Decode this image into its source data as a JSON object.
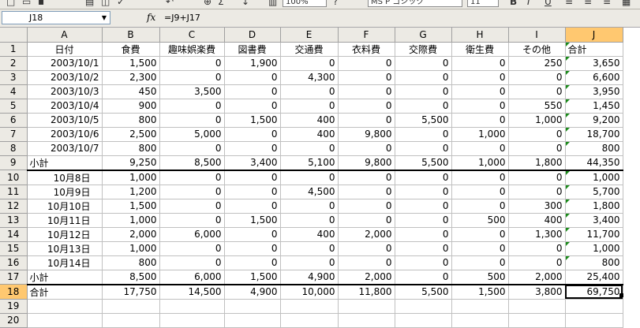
{
  "toolbar": {
    "zoom": "100%",
    "font_name": "MS P ゴシック",
    "font_size": "11",
    "bold": "B",
    "italic": "I",
    "underline": "U"
  },
  "formula_bar": {
    "name_box": "J18",
    "fx": "fx",
    "formula": "=J9+J17"
  },
  "sheet": {
    "columns": [
      "A",
      "B",
      "C",
      "D",
      "E",
      "F",
      "G",
      "H",
      "I",
      "J"
    ],
    "selected_cell": "J18",
    "rows": [
      {
        "n": "1",
        "cells": [
          "日付",
          "食費",
          "趣味娯楽費",
          "図書費",
          "交通費",
          "衣料費",
          "交際費",
          "衛生費",
          "その他",
          "合計"
        ]
      },
      {
        "n": "2",
        "cells": [
          "2003/10/1",
          "1,500",
          "0",
          "1,900",
          "0",
          "0",
          "0",
          "0",
          "250",
          "3,650"
        ]
      },
      {
        "n": "3",
        "cells": [
          "2003/10/2",
          "2,300",
          "0",
          "0",
          "4,300",
          "0",
          "0",
          "0",
          "0",
          "6,600"
        ]
      },
      {
        "n": "4",
        "cells": [
          "2003/10/3",
          "450",
          "3,500",
          "0",
          "0",
          "0",
          "0",
          "0",
          "0",
          "3,950"
        ]
      },
      {
        "n": "5",
        "cells": [
          "2003/10/4",
          "900",
          "0",
          "0",
          "0",
          "0",
          "0",
          "0",
          "550",
          "1,450"
        ]
      },
      {
        "n": "6",
        "cells": [
          "2003/10/5",
          "800",
          "0",
          "1,500",
          "400",
          "0",
          "5,500",
          "0",
          "1,000",
          "9,200"
        ]
      },
      {
        "n": "7",
        "cells": [
          "2003/10/6",
          "2,500",
          "5,000",
          "0",
          "400",
          "9,800",
          "0",
          "1,000",
          "0",
          "18,700"
        ]
      },
      {
        "n": "8",
        "cells": [
          "2003/10/7",
          "800",
          "0",
          "0",
          "0",
          "0",
          "0",
          "0",
          "0",
          "800"
        ]
      },
      {
        "n": "9",
        "cells": [
          "小計",
          "9,250",
          "8,500",
          "3,400",
          "5,100",
          "9,800",
          "5,500",
          "1,000",
          "1,800",
          "44,350"
        ]
      },
      {
        "n": "10",
        "cells": [
          "10月8日",
          "1,000",
          "0",
          "0",
          "0",
          "0",
          "0",
          "0",
          "0",
          "1,000"
        ]
      },
      {
        "n": "11",
        "cells": [
          "10月9日",
          "1,200",
          "0",
          "0",
          "4,500",
          "0",
          "0",
          "0",
          "0",
          "5,700"
        ]
      },
      {
        "n": "12",
        "cells": [
          "10月10日",
          "1,500",
          "0",
          "0",
          "0",
          "0",
          "0",
          "0",
          "300",
          "1,800"
        ]
      },
      {
        "n": "13",
        "cells": [
          "10月11日",
          "1,000",
          "0",
          "1,500",
          "0",
          "0",
          "0",
          "500",
          "400",
          "3,400"
        ]
      },
      {
        "n": "14",
        "cells": [
          "10月12日",
          "2,000",
          "6,000",
          "0",
          "400",
          "2,000",
          "0",
          "0",
          "1,300",
          "11,700"
        ]
      },
      {
        "n": "15",
        "cells": [
          "10月13日",
          "1,000",
          "0",
          "0",
          "0",
          "0",
          "0",
          "0",
          "0",
          "1,000"
        ]
      },
      {
        "n": "16",
        "cells": [
          "10月14日",
          "800",
          "0",
          "0",
          "0",
          "0",
          "0",
          "0",
          "0",
          "800"
        ]
      },
      {
        "n": "17",
        "cells": [
          "小計",
          "8,500",
          "6,000",
          "1,500",
          "4,900",
          "2,000",
          "0",
          "500",
          "2,000",
          "25,400"
        ]
      },
      {
        "n": "18",
        "cells": [
          "合計",
          "17,750",
          "14,500",
          "4,900",
          "10,000",
          "11,800",
          "5,500",
          "1,500",
          "3,800",
          "69,750"
        ]
      },
      {
        "n": "19",
        "cells": [
          "",
          "",
          "",
          "",
          "",
          "",
          "",
          "",
          "",
          ""
        ]
      },
      {
        "n": "20",
        "cells": [
          "",
          "",
          "",
          "",
          "",
          "",
          "",
          "",
          "",
          ""
        ]
      }
    ]
  }
}
